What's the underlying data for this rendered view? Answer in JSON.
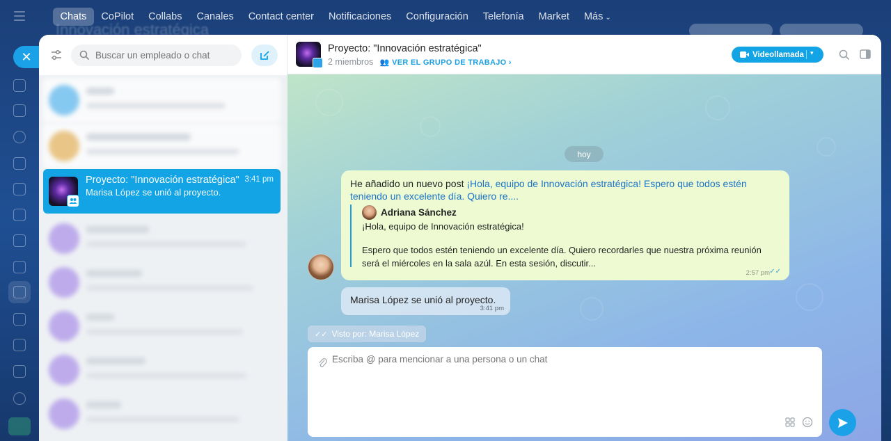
{
  "topnav": {
    "items": [
      {
        "label": "Chats"
      },
      {
        "label": "CoPilot"
      },
      {
        "label": "Collabs"
      },
      {
        "label": "Canales"
      },
      {
        "label": "Contact center"
      },
      {
        "label": "Notificaciones"
      },
      {
        "label": "Configuración"
      },
      {
        "label": "Telefonía"
      },
      {
        "label": "Market"
      },
      {
        "label": "Más"
      }
    ]
  },
  "background": {
    "title": "Innovación estratégica"
  },
  "search": {
    "placeholder": "Buscar un empleado o chat"
  },
  "active_chat_item": {
    "title": "Proyecto: \"Innovación estratégica\"",
    "time": "3:41 pm",
    "subtitle": "Marisa López se unió al proyecto."
  },
  "header": {
    "title": "Proyecto: \"Innovación estratégica\"",
    "members": "2 miembros",
    "group_link": "VER EL GRUPO DE TRABAJO",
    "video_call": "Videollamada"
  },
  "messages": {
    "day": "hoy",
    "post": {
      "prefix": "He añadido un nuevo post ",
      "link": "¡Hola, equipo de Innovación estratégica! Espero que todos estén teniendo un excelente día. Quiero re....",
      "quote_author": "Adriana Sánchez",
      "quote_line1": "¡Hola, equipo de Innovación estratégica!",
      "quote_line2": "Espero que todos estén teniendo un excelente día. Quiero recordarles que nuestra próxima reunión será el miércoles en la sala azúl. En esta sesión, discutir...",
      "time": "2:57 pm"
    },
    "system": {
      "text": "Marisa López se unió al proyecto.",
      "time": "3:41 pm"
    },
    "seen": "Visto por: Marisa López"
  },
  "composer": {
    "placeholder": "Escriba @ para mencionar a una persona o un chat"
  },
  "colors": {
    "accent": "#12a4e4",
    "bubble": "#eefbd2"
  }
}
